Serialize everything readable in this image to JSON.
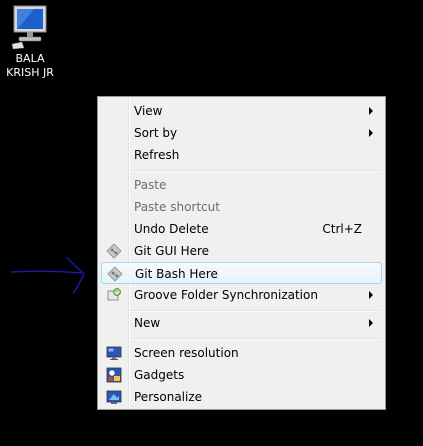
{
  "desktop": {
    "background": "#000000",
    "icon": {
      "label": "BALA KRISH JR",
      "icon": "computer-monitor-icon"
    }
  },
  "annotation": {
    "color": "#1a1aa8",
    "icon": "arrow-right-icon"
  },
  "context_menu": {
    "items": {
      "view": {
        "label": "View",
        "has_submenu": true
      },
      "sort_by": {
        "label": "Sort by",
        "has_submenu": true
      },
      "refresh": {
        "label": "Refresh"
      },
      "paste": {
        "label": "Paste",
        "disabled": true
      },
      "paste_shortcut": {
        "label": "Paste shortcut",
        "disabled": true
      },
      "undo_delete": {
        "label": "Undo Delete",
        "shortcut": "Ctrl+Z"
      },
      "git_gui": {
        "label": "Git GUI Here",
        "icon": "git-icon"
      },
      "git_bash": {
        "label": "Git Bash Here",
        "icon": "git-icon",
        "highlighted": true
      },
      "groove": {
        "label": "Groove Folder Synchronization",
        "icon": "groove-icon",
        "has_submenu": true
      },
      "new": {
        "label": "New",
        "has_submenu": true
      },
      "screen_resolution": {
        "label": "Screen resolution",
        "icon": "screen-resolution-icon"
      },
      "gadgets": {
        "label": "Gadgets",
        "icon": "gadgets-icon"
      },
      "personalize": {
        "label": "Personalize",
        "icon": "personalize-icon"
      }
    },
    "colors": {
      "background": "#f0f0f0",
      "highlight_border": "#a8d8eb",
      "disabled_text": "#6d6d6d"
    }
  }
}
